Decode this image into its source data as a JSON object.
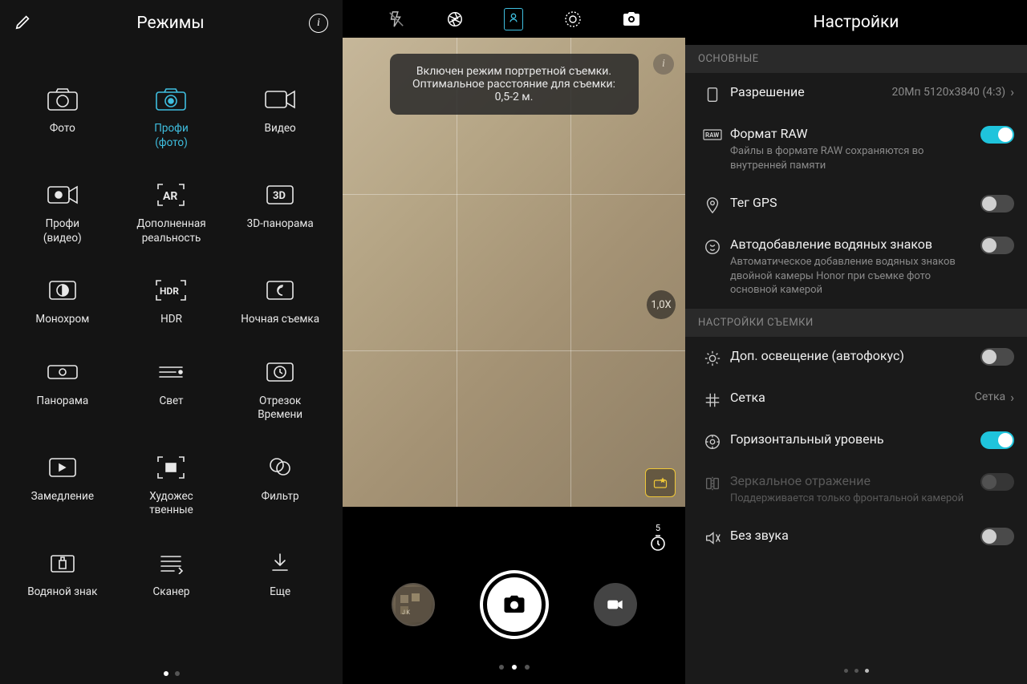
{
  "panel1": {
    "title": "Режимы",
    "modes": [
      {
        "id": "photo",
        "label": "Фото",
        "icon": "camera-icon"
      },
      {
        "id": "pro-photo",
        "label": "Профи\n(фото)",
        "icon": "camera-pro-icon",
        "selected": true
      },
      {
        "id": "video",
        "label": "Видео",
        "icon": "video-icon"
      },
      {
        "id": "pro-video",
        "label": "Профи\n(видео)",
        "icon": "video-pro-icon"
      },
      {
        "id": "ar",
        "label": "Дополненная\nреальность",
        "icon": "ar-icon"
      },
      {
        "id": "3d-pano",
        "label": "3D-панорама",
        "icon": "3d-icon"
      },
      {
        "id": "monochrome",
        "label": "Монохром",
        "icon": "contrast-icon"
      },
      {
        "id": "hdr",
        "label": "HDR",
        "icon": "hdr-icon"
      },
      {
        "id": "night",
        "label": "Ночная съемка",
        "icon": "moon-icon"
      },
      {
        "id": "panorama",
        "label": "Панорама",
        "icon": "panorama-icon"
      },
      {
        "id": "light",
        "label": "Свет",
        "icon": "light-icon"
      },
      {
        "id": "timelapse",
        "label": "Отрезок\nВремени",
        "icon": "timelapse-icon"
      },
      {
        "id": "slowmo",
        "label": "Замедление",
        "icon": "slowmo-icon"
      },
      {
        "id": "artistic",
        "label": "Художес\nтвенные",
        "icon": "artistic-icon"
      },
      {
        "id": "filter",
        "label": "Фильтр",
        "icon": "filter-icon"
      },
      {
        "id": "watermark",
        "label": "Водяной знак",
        "icon": "watermark-icon"
      },
      {
        "id": "scanner",
        "label": "Сканер",
        "icon": "scanner-icon"
      },
      {
        "id": "more",
        "label": "Еще",
        "icon": "download-icon"
      }
    ],
    "page_dots": {
      "count": 2,
      "active": 0
    }
  },
  "panel2": {
    "toast": "Включен режим портретной съемки. Оптимальное расстояние для съемки: 0,5-2 м.",
    "zoom": "1,0X",
    "timer": "5",
    "page_dots": {
      "count": 3,
      "active": 1
    }
  },
  "panel3": {
    "title": "Настройки",
    "sections": [
      {
        "header": "ОСНОВНЫЕ",
        "items": [
          {
            "id": "resolution",
            "icon": "resolution-icon",
            "title": "Разрешение",
            "value": "20Мп 5120x3840 (4:3)",
            "type": "nav"
          },
          {
            "id": "raw",
            "icon": "raw-icon",
            "title": "Формат RAW",
            "sub": "Файлы в формате RAW сохраняются во внутренней памяти",
            "type": "toggle",
            "on": true
          },
          {
            "id": "gps",
            "icon": "location-icon",
            "title": "Тег GPS",
            "type": "toggle",
            "on": false
          },
          {
            "id": "watermark",
            "icon": "watermark-setting-icon",
            "title": "Автодобавление водяных знаков",
            "sub": "Автоматическое добавление водяных знаков двойной камеры Honor при съемке фото основной камерой",
            "type": "toggle",
            "on": false
          }
        ]
      },
      {
        "header": "НАСТРОЙКИ СЪЕМКИ",
        "items": [
          {
            "id": "af-assist",
            "icon": "brightness-icon",
            "title": "Доп. освещение (автофокус)",
            "type": "toggle",
            "on": false
          },
          {
            "id": "grid",
            "icon": "grid-icon",
            "title": "Сетка",
            "value": "Сетка",
            "type": "nav"
          },
          {
            "id": "horizon",
            "icon": "level-icon",
            "title": "Горизонтальный уровень",
            "type": "toggle",
            "on": true
          },
          {
            "id": "mirror",
            "icon": "mirror-icon",
            "title": "Зеркальное отражение",
            "sub": "Поддерживается только фронтальной камерой",
            "type": "toggle",
            "on": false,
            "disabled": true
          },
          {
            "id": "mute",
            "icon": "mute-icon",
            "title": "Без звука",
            "type": "toggle",
            "on": false
          }
        ]
      }
    ],
    "page_dots": {
      "count": 3,
      "active": 2
    }
  }
}
